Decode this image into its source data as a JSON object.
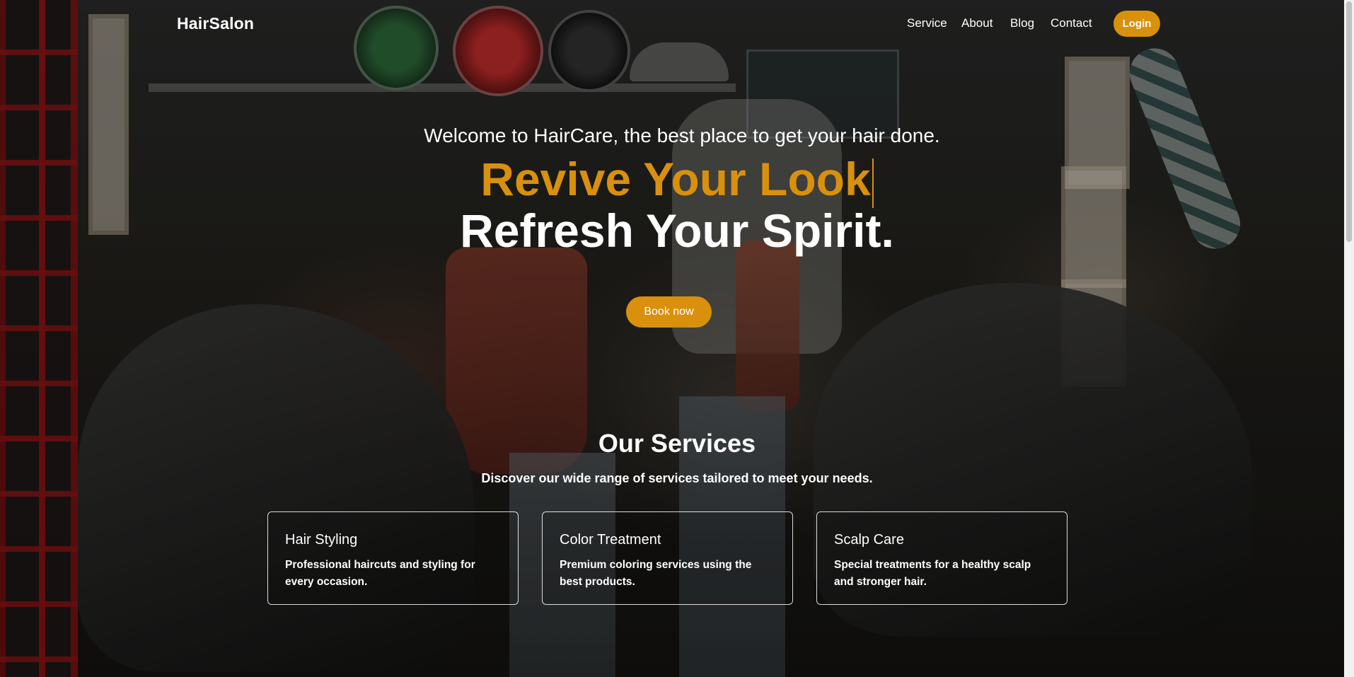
{
  "brand": {
    "name": "HairSalon"
  },
  "nav": {
    "items": [
      {
        "label": "Service"
      },
      {
        "label": "About"
      },
      {
        "label": "Blog"
      },
      {
        "label": "Contact"
      }
    ],
    "login_label": "Login"
  },
  "hero": {
    "welcome": "Welcome to HairCare, the best place to get your hair done.",
    "accent": "Revive Your Look",
    "title": "Refresh Your Spirit.",
    "cta_label": "Book now"
  },
  "services": {
    "title": "Our Services",
    "subtitle": "Discover our wide range of services tailored to meet your needs.",
    "cards": [
      {
        "title": "Hair Styling",
        "description": "Professional haircuts and styling for every occasion."
      },
      {
        "title": "Color Treatment",
        "description": "Premium coloring services using the best products."
      },
      {
        "title": "Scalp Care",
        "description": "Special treatments for a healthy scalp and stronger hair."
      }
    ]
  },
  "colors": {
    "accent": "#d8900d",
    "text": "#ffffff"
  }
}
